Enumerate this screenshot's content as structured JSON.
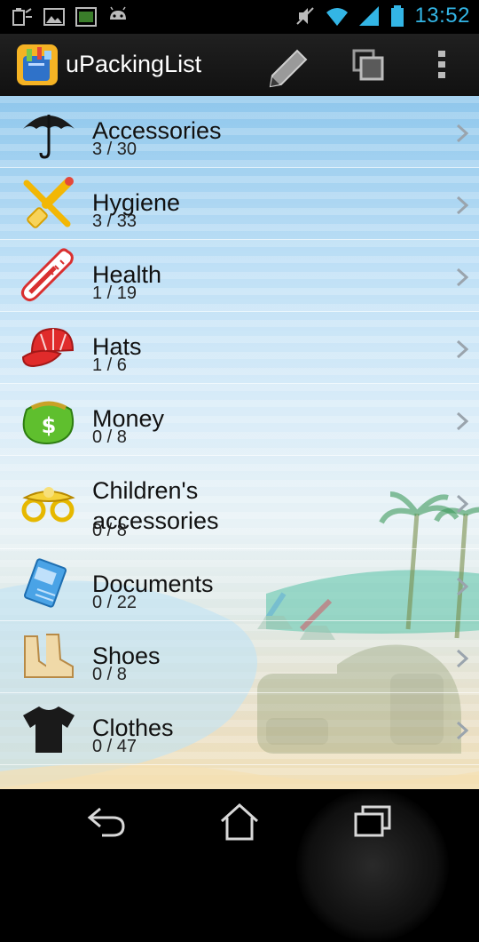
{
  "status_bar": {
    "time": "13:52",
    "left_icons": [
      "battery-saver-icon",
      "gallery-icon",
      "screenshot-icon",
      "android-debug-icon"
    ],
    "right_icons": [
      "mute-icon",
      "wifi-icon",
      "signal-icon",
      "battery-icon"
    ],
    "accent": "#33b5e5"
  },
  "action_bar": {
    "title": "uPackingList",
    "actions": [
      "edit-icon",
      "copy-icon",
      "overflow-menu-icon"
    ]
  },
  "categories": [
    {
      "name": "Accessories",
      "count": "3 / 30",
      "icon": "umbrella-icon"
    },
    {
      "name": "Hygiene",
      "count": "3 / 33",
      "icon": "toothbrush-icon"
    },
    {
      "name": "Health",
      "count": "1 / 19",
      "icon": "thermometer-icon"
    },
    {
      "name": "Hats",
      "count": "1 / 6",
      "icon": "cap-icon"
    },
    {
      "name": "Money",
      "count": "0 / 8",
      "icon": "money-bag-icon"
    },
    {
      "name_line1": "Children's",
      "name_line2": "accessories",
      "count": "0 / 8",
      "icon": "pacifier-icon"
    },
    {
      "name": "Documents",
      "count": "0 / 22",
      "icon": "documents-icon"
    },
    {
      "name": "Shoes",
      "count": "0 / 8",
      "icon": "boots-icon"
    },
    {
      "name": "Clothes",
      "count": "0 / 47",
      "icon": "tshirt-icon"
    }
  ],
  "nav_bar": {
    "buttons": [
      "back-icon",
      "home-icon",
      "recent-apps-icon"
    ]
  }
}
